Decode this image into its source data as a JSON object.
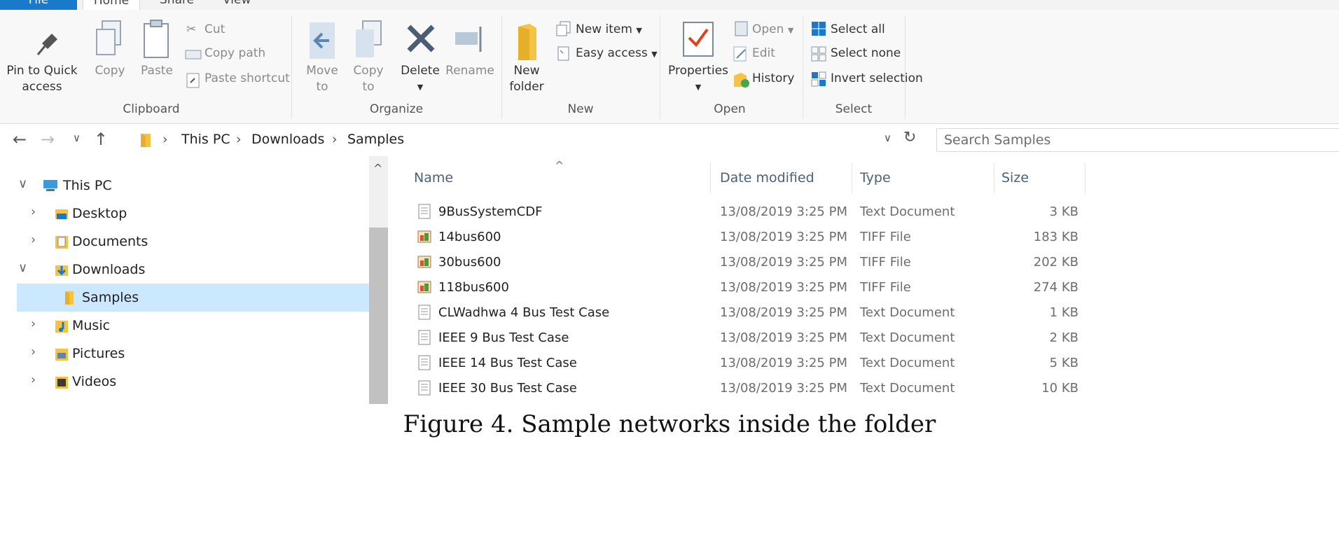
{
  "tabs": [
    {
      "label": "File"
    },
    {
      "label": "Home"
    },
    {
      "label": "Share"
    },
    {
      "label": "View"
    }
  ],
  "ribbon": {
    "clipboard": {
      "group_label": "Clipboard",
      "pin_line1": "Pin to Quick",
      "pin_line2": "access",
      "copy": "Copy",
      "paste": "Paste",
      "cut": "Cut",
      "copy_path": "Copy path",
      "paste_shortcut": "Paste shortcut"
    },
    "organize": {
      "group_label": "Organize",
      "move_line1": "Move",
      "move_line2": "to",
      "copy_line1": "Copy",
      "copy_line2": "to",
      "delete": "Delete",
      "rename": "Rename"
    },
    "new": {
      "group_label": "New",
      "new_folder_line1": "New",
      "new_folder_line2": "folder",
      "new_item": "New item",
      "easy_access": "Easy access"
    },
    "open": {
      "group_label": "Open",
      "properties": "Properties",
      "open": "Open",
      "edit": "Edit",
      "history": "History"
    },
    "select": {
      "group_label": "Select",
      "select_all": "Select all",
      "select_none": "Select none",
      "invert_selection": "Invert selection"
    }
  },
  "address": {
    "crumbs": [
      "This PC",
      "Downloads",
      "Samples"
    ],
    "search_placeholder": "Search Samples"
  },
  "nav": [
    {
      "label": "This PC",
      "state": "expanded"
    },
    {
      "label": "Desktop",
      "state": "collapsed"
    },
    {
      "label": "Documents",
      "state": "collapsed"
    },
    {
      "label": "Downloads",
      "state": "expanded"
    },
    {
      "label": "Samples",
      "state": "selected"
    },
    {
      "label": "Music",
      "state": "collapsed"
    },
    {
      "label": "Pictures",
      "state": "collapsed"
    },
    {
      "label": "Videos",
      "state": "collapsed"
    }
  ],
  "columns": {
    "name": "Name",
    "date": "Date modified",
    "type": "Type",
    "size": "Size"
  },
  "files": [
    {
      "name": "9BusSystemCDF",
      "date": "13/08/2019 3:25 PM",
      "type": "Text Document",
      "size": "3 KB",
      "icon": "text-file-icon"
    },
    {
      "name": "14bus600",
      "date": "13/08/2019 3:25 PM",
      "type": "TIFF File",
      "size": "183 KB",
      "icon": "image-file-icon"
    },
    {
      "name": "30bus600",
      "date": "13/08/2019 3:25 PM",
      "type": "TIFF File",
      "size": "202 KB",
      "icon": "image-file-icon"
    },
    {
      "name": "118bus600",
      "date": "13/08/2019 3:25 PM",
      "type": "TIFF File",
      "size": "274 KB",
      "icon": "image-file-icon"
    },
    {
      "name": "CLWadhwa 4 Bus Test Case",
      "date": "13/08/2019 3:25 PM",
      "type": "Text Document",
      "size": "1 KB",
      "icon": "text-file-icon"
    },
    {
      "name": "IEEE 9 Bus Test Case",
      "date": "13/08/2019 3:25 PM",
      "type": "Text Document",
      "size": "2 KB",
      "icon": "text-file-icon"
    },
    {
      "name": "IEEE 14 Bus Test Case",
      "date": "13/08/2019 3:25 PM",
      "type": "Text Document",
      "size": "5 KB",
      "icon": "text-file-icon"
    },
    {
      "name": "IEEE 30 Bus Test Case",
      "date": "13/08/2019 3:25 PM",
      "type": "Text Document",
      "size": "10 KB",
      "icon": "text-file-icon"
    }
  ],
  "caption": "Figure 4. Sample networks inside the folder",
  "colors": {
    "accent": "#1979ca",
    "selection": "#cce8ff",
    "folder": "#f5c343"
  }
}
